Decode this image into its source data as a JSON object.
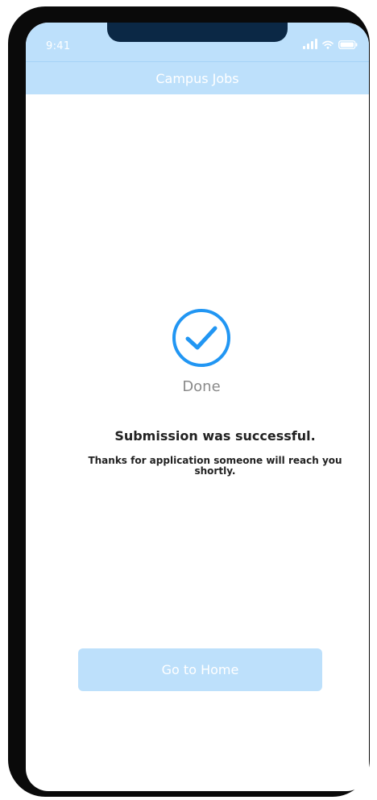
{
  "status_bar": {
    "time": "9:41"
  },
  "nav": {
    "title": "Campus Jobs"
  },
  "result": {
    "icon": "check-circle-icon",
    "status_label": "Done",
    "title": "Submission was successful.",
    "message": "Thanks for application someone will  reach you shortly."
  },
  "actions": {
    "home_label": "Go to Home"
  },
  "colors": {
    "header_bg": "#bde0fb",
    "accent": "#2196f3",
    "button_bg": "#bde0fb",
    "device_frame": "#0a0a0a",
    "notch": "#0b2845"
  }
}
